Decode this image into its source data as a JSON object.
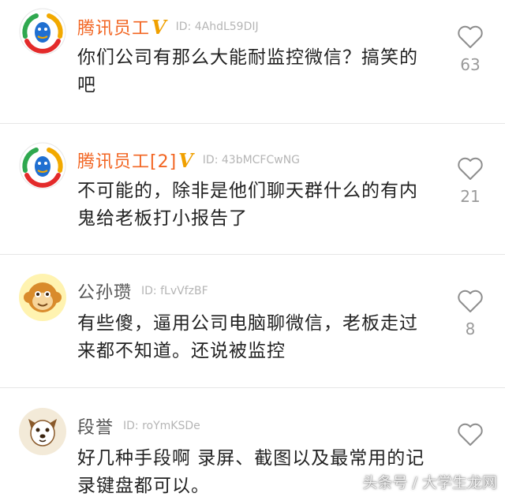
{
  "comments": [
    {
      "username": "腾讯员工",
      "badge": "V",
      "user_id": "ID: 4AhdL59DIJ",
      "text": "你们公司有那么大能耐监控微信？搞笑的吧",
      "likes": "63",
      "avatar_icon": "tencent-logo-icon"
    },
    {
      "username": "腾讯员工[2]",
      "badge": "V",
      "user_id": "ID: 43bMCFCwNG",
      "text": "不可能的，除非是他们聊天群什么的有内鬼给老板打小报告了",
      "likes": "21",
      "avatar_icon": "tencent-logo-icon"
    },
    {
      "username": "公孙瓒",
      "user_id": "ID: fLvVfzBF",
      "text": "有些傻，逼用公司电脑聊微信，老板走过来都不知道。还说被监控",
      "likes": "8",
      "avatar_icon": "monkey-avatar-icon"
    },
    {
      "username": "段誉",
      "user_id": "ID: roYmKSDe",
      "text": "好几种手段啊 录屏、截图以及最常用的记录键盘都可以。",
      "likes": "",
      "avatar_icon": "dog-avatar-icon"
    }
  ],
  "watermark": "头条号 / 大学生龙网",
  "colors": {
    "vip_name": "#f26522",
    "badge": "#f0a000",
    "normal_name": "#555555",
    "meta": "#b5b5b5",
    "like_count": "#9a9a9a"
  }
}
